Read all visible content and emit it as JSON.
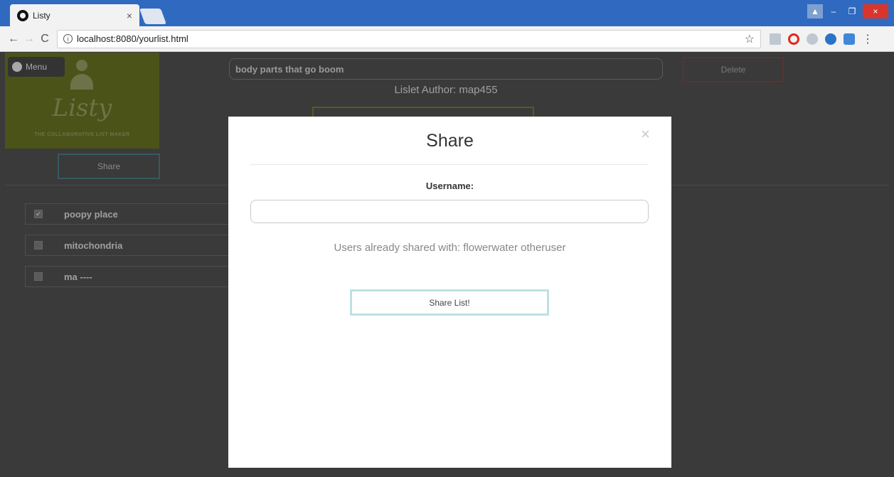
{
  "browser": {
    "tab_title": "Listy",
    "tab_close": "×",
    "url": "localhost:8080/yourlist.html",
    "info_glyph": "i",
    "back_glyph": "←",
    "forward_glyph": "→",
    "reload_glyph": "C",
    "star_glyph": "☆",
    "menu_glyph": "⋮",
    "window_controls": {
      "user": "▲",
      "minimize": "–",
      "restore": "❐",
      "close": "×"
    }
  },
  "sidebar": {
    "menu_label": "Menu",
    "logo_text": "Listy",
    "tagline": "THE COLLABORATIVE LIST MAKER",
    "share_label": "Share"
  },
  "header": {
    "list_title": "body parts that go boom",
    "delete_label": "Delete",
    "author": "Lislet Author: map455"
  },
  "list": {
    "items": [
      {
        "label": "poopy place",
        "checked": "✔"
      },
      {
        "label": "mitochondria",
        "checked": ""
      },
      {
        "label": "ma ----",
        "checked": ""
      }
    ]
  },
  "modal": {
    "title": "Share",
    "close_glyph": "×",
    "username_label": "Username:",
    "username_value": "",
    "already_shared": "Users already shared with: flowerwater otheruser",
    "share_button": "Share List!"
  }
}
